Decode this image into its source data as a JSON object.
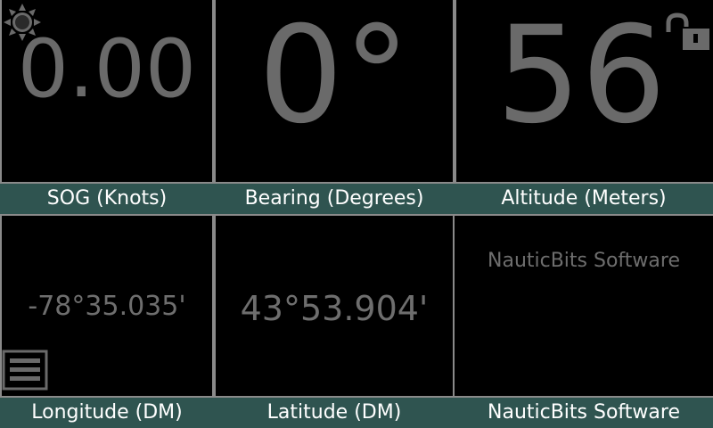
{
  "panels": {
    "sog": {
      "value": "0.00",
      "label": "SOG (Knots)"
    },
    "bearing": {
      "value": "0°",
      "label": "Bearing (Degrees)"
    },
    "altitude": {
      "value": "56",
      "label": "Altitude (Meters)"
    },
    "longitude": {
      "value": "-78°35.035'",
      "label": "Longitude (DM)"
    },
    "latitude": {
      "value": "43°53.904'",
      "label": "Latitude (DM)"
    },
    "brand": {
      "value": "NauticBits Software",
      "label": "NauticBits Software"
    }
  },
  "icons": {
    "top_left": "brightness-icon",
    "top_right": "unlock-icon",
    "bottom_left": "menu-icon"
  },
  "colors": {
    "label_bar": "#2f5450",
    "value_text": "#6e6e6e",
    "panel_bg": "#000000",
    "border": "#8a8a8a"
  }
}
